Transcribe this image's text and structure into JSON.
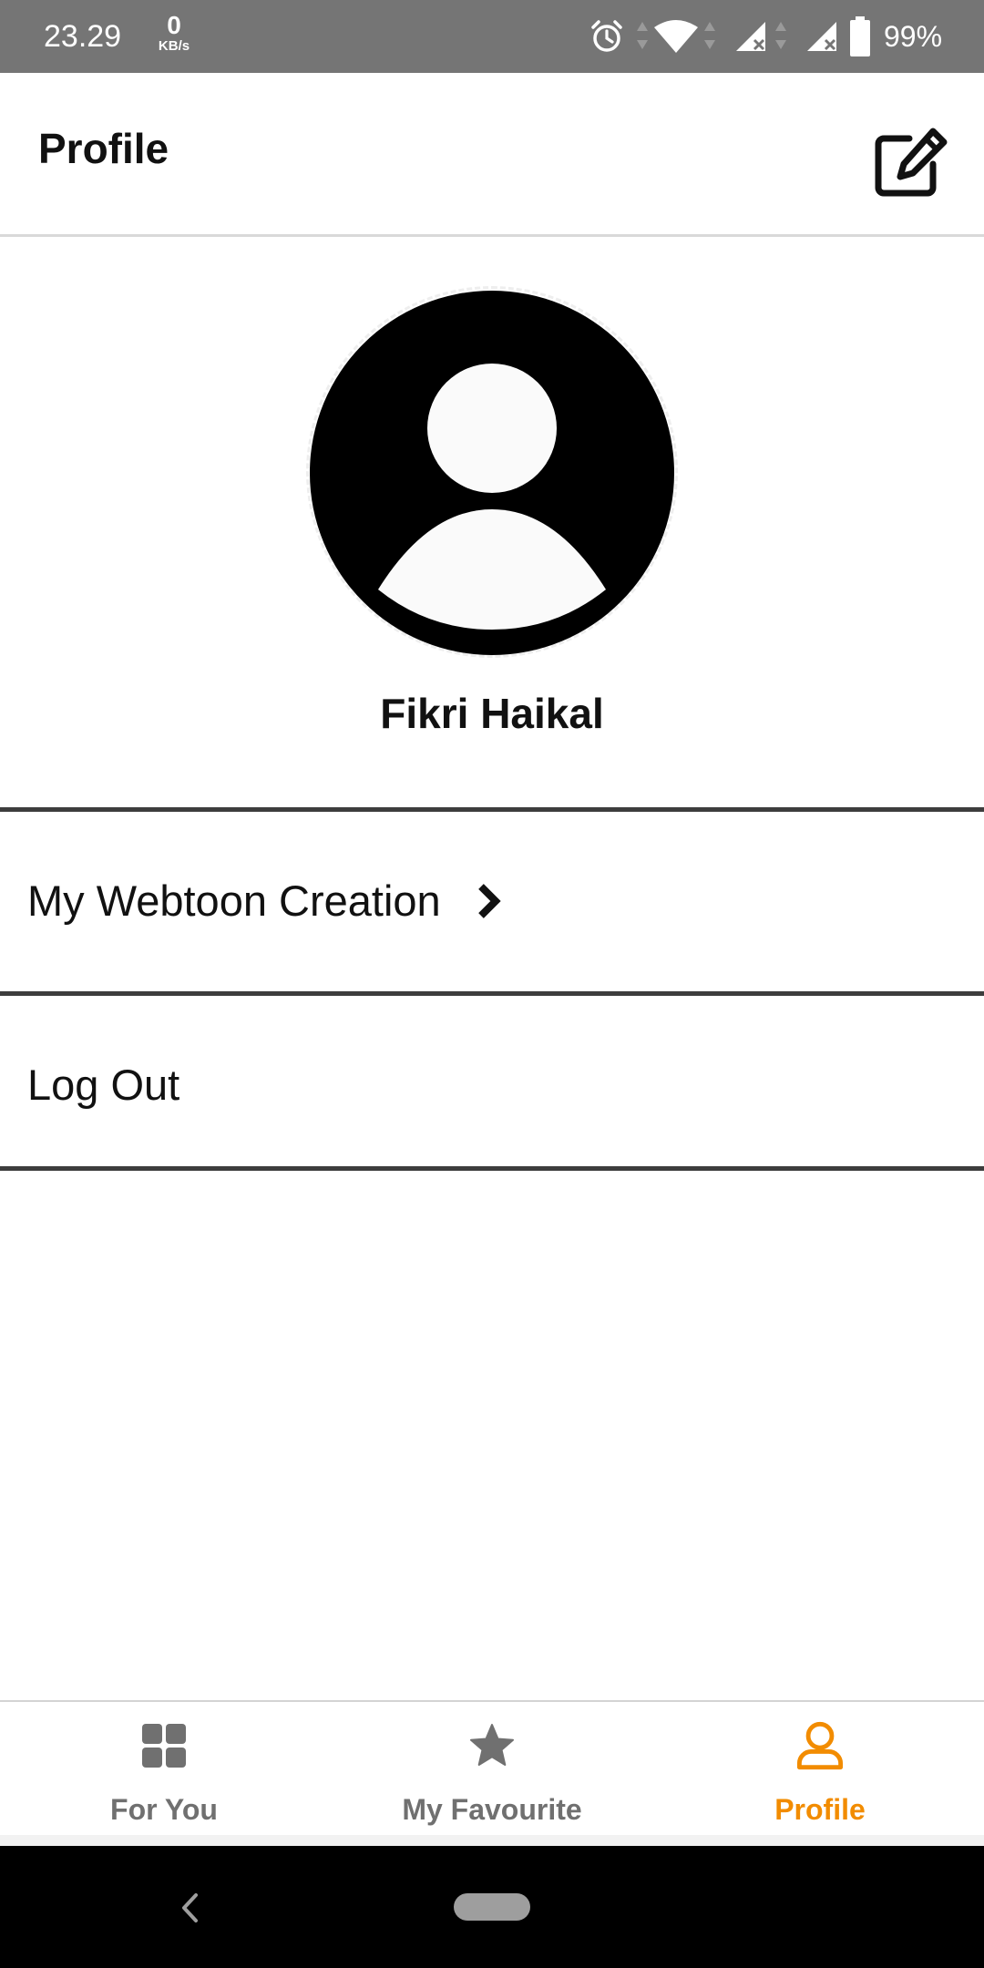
{
  "status_bar": {
    "time": "23.29",
    "net_speed_value": "0",
    "net_speed_unit": "KB/s",
    "battery_percent": "99%",
    "icons": [
      "alarm-icon",
      "wifi-icon",
      "signal-icon",
      "signal-icon",
      "battery-icon"
    ]
  },
  "header": {
    "title": "Profile",
    "edit_icon": "edit-icon"
  },
  "profile": {
    "avatar_icon": "user-avatar-icon",
    "name": "Fikri Haikal"
  },
  "menu": {
    "items": [
      {
        "label": "My Webtoon Creation",
        "icon": "chevron-right-icon"
      },
      {
        "label": "Log Out"
      }
    ]
  },
  "bottom_nav": {
    "active_color": "#f28c00",
    "inactive_color": "#707070",
    "items": [
      {
        "label": "For You",
        "icon": "grid-icon",
        "active": false
      },
      {
        "label": "My Favourite",
        "icon": "star-icon",
        "active": false
      },
      {
        "label": "Profile",
        "icon": "user-icon",
        "active": true
      }
    ]
  },
  "system_nav": {
    "icons": [
      "back-icon",
      "home-pill-icon"
    ]
  }
}
